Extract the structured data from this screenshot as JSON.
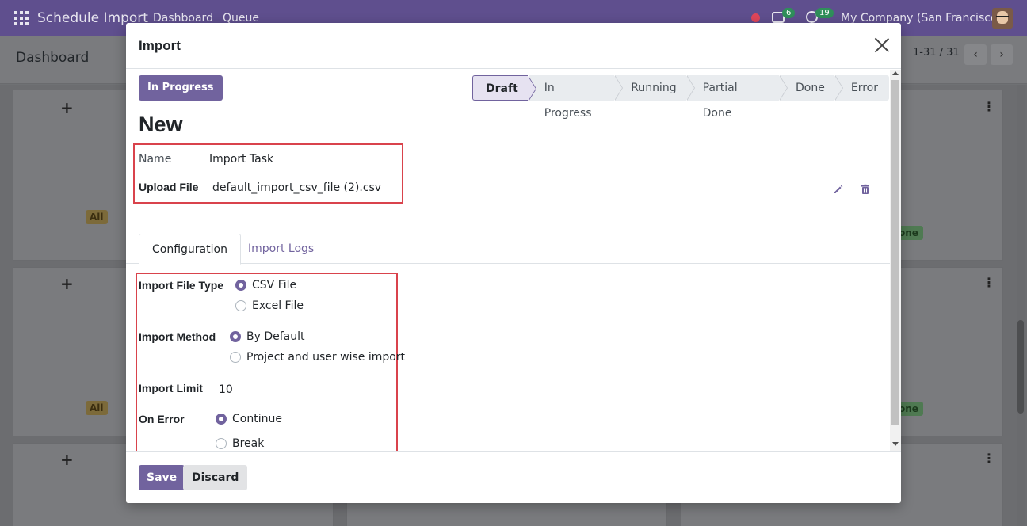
{
  "app": {
    "title": "Schedule Import",
    "menu": [
      "Dashboard",
      "Queue"
    ],
    "chat_count": "6",
    "activity_count": "19",
    "company": "My Company (San Francisco)"
  },
  "controlbar": {
    "title": "Dashboard",
    "pager": "1-31 / 31"
  },
  "kanban": {
    "badge_all": "All",
    "badge_done": "one"
  },
  "modal": {
    "title": "Import",
    "status_button": "In Progress",
    "stages": [
      "Draft",
      "In Progress",
      "Running",
      "Partial Done",
      "Done",
      "Error"
    ],
    "active_stage": "Draft",
    "record_title": "New",
    "name_label": "Name",
    "name_value": "Import Task",
    "upload_label": "Upload File",
    "upload_value": "default_import_csv_file (2).csv",
    "tabs": [
      "Configuration",
      "Import Logs"
    ],
    "config": {
      "file_type_label": "Import File Type",
      "file_type_options": [
        "CSV File",
        "Excel File"
      ],
      "file_type_selected": "CSV File",
      "method_label": "Import Method",
      "method_options": [
        "By Default",
        "Project and user wise import"
      ],
      "method_selected": "By Default",
      "limit_label": "Import Limit",
      "limit_value": "10",
      "on_error_label": "On Error",
      "on_error_options": [
        "Continue",
        "Break"
      ],
      "on_error_selected": "Continue"
    },
    "save_label": "Save",
    "discard_label": "Discard"
  },
  "colors": {
    "primary": "#71639e",
    "navbar": "#5f4f8e",
    "highlight": "#d9434c"
  }
}
